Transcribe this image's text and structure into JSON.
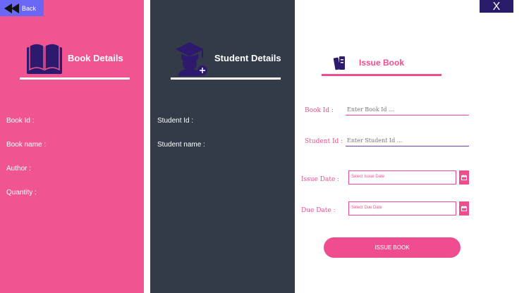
{
  "header": {
    "back_label": "Back",
    "close_label": "X"
  },
  "book_panel": {
    "title": "Book Details",
    "fields": [
      "Book Id :",
      "Book name :",
      "Author :",
      "Quantity :"
    ]
  },
  "student_panel": {
    "title": "Student Details",
    "fields": [
      "Student Id :",
      "Student name :"
    ]
  },
  "issue_panel": {
    "title": "Issue Book",
    "book_id_label": "Book Id :",
    "book_id_placeholder": "Enter Book Id ...",
    "student_id_label": "Student Id :",
    "student_id_placeholder": "Enter Student Id ...",
    "issue_date_label": "Issue Date :",
    "issue_date_placeholder": "Select Issue Date",
    "due_date_label": "Due Date :",
    "due_date_placeholder": "Select Due Date",
    "submit_label": "ISSUE BOOK"
  },
  "colors": {
    "pink": "#ef4d8f",
    "dark": "#343b48",
    "purple": "#6a67f5",
    "close": "#2b1b6b"
  },
  "icons": [
    "rewind-icon",
    "book-icon",
    "graduate-icon",
    "books-icon",
    "calendar-icon"
  ]
}
